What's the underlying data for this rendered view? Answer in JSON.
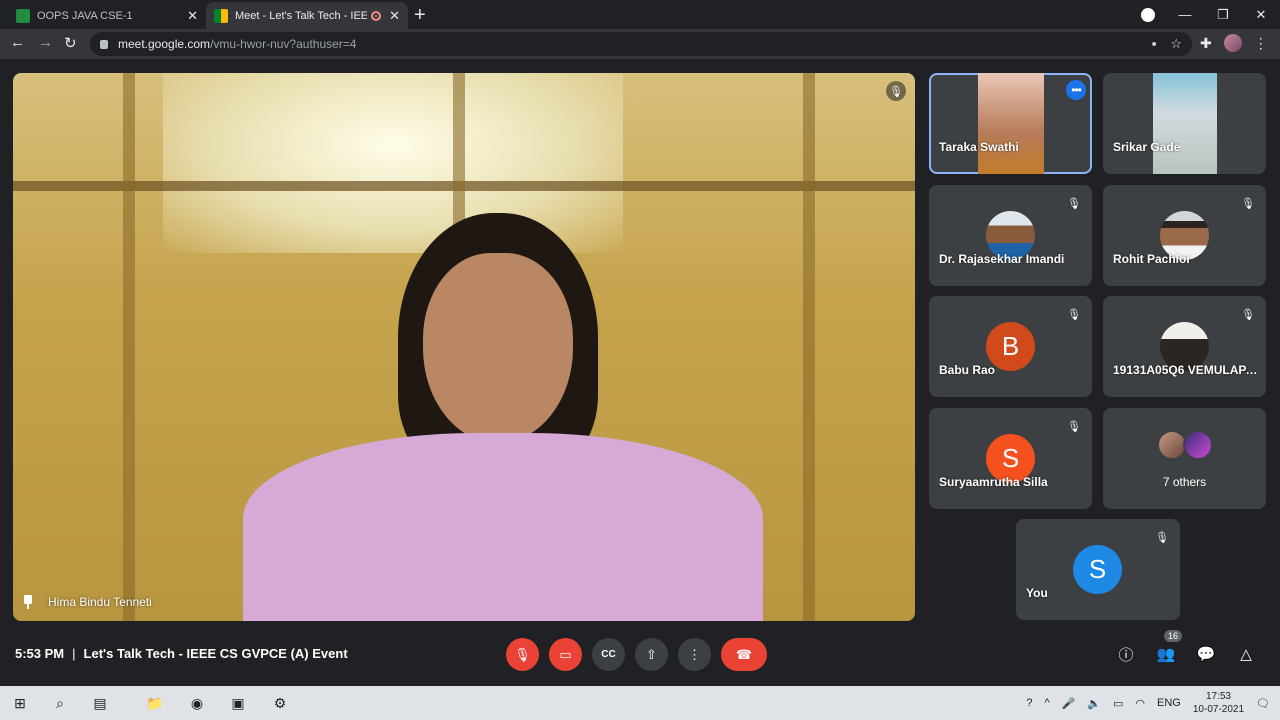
{
  "browser": {
    "tabs": [
      {
        "title": "OOPS JAVA CSE-1",
        "active": false
      },
      {
        "title": "Meet - Let's Talk Tech - IEEE C",
        "active": true
      }
    ],
    "url_host": "meet.google.com",
    "url_path": "/vmu-hwor-nuv?authuser=4"
  },
  "main_speaker": {
    "name": "Hima Bindu Tenneti"
  },
  "participants": [
    {
      "name": "Taraka Swathi",
      "type": "video"
    },
    {
      "name": "Srikar Gade",
      "type": "video"
    },
    {
      "name": "Dr. Rajasekhar Imandi",
      "type": "photo"
    },
    {
      "name": "Rohit Pachlor",
      "type": "photo"
    },
    {
      "name": "Babu Rao",
      "type": "initial",
      "initial": "B",
      "color": "#d04a1b"
    },
    {
      "name": "19131A05Q6 VEMULAPA...",
      "type": "photo"
    },
    {
      "name": "Suryaamrutha Silla",
      "type": "initial",
      "initial": "S",
      "color": "#f4511e"
    },
    {
      "name": "You",
      "type": "initial",
      "initial": "S",
      "color": "#1e88e5"
    }
  ],
  "others": {
    "label": "7 others"
  },
  "meeting": {
    "time": "5:53 PM",
    "separator": "|",
    "title": "Let's Talk Tech - IEEE CS GVPCE (A) Event"
  },
  "people_count": "16",
  "taskbar": {
    "lang": "ENG",
    "time": "17:53",
    "date": "10-07-2021"
  },
  "colors": {
    "accent": "#8ab4f8",
    "danger": "#ea4335",
    "tile_bg": "#3c4043",
    "bg": "#202124"
  }
}
